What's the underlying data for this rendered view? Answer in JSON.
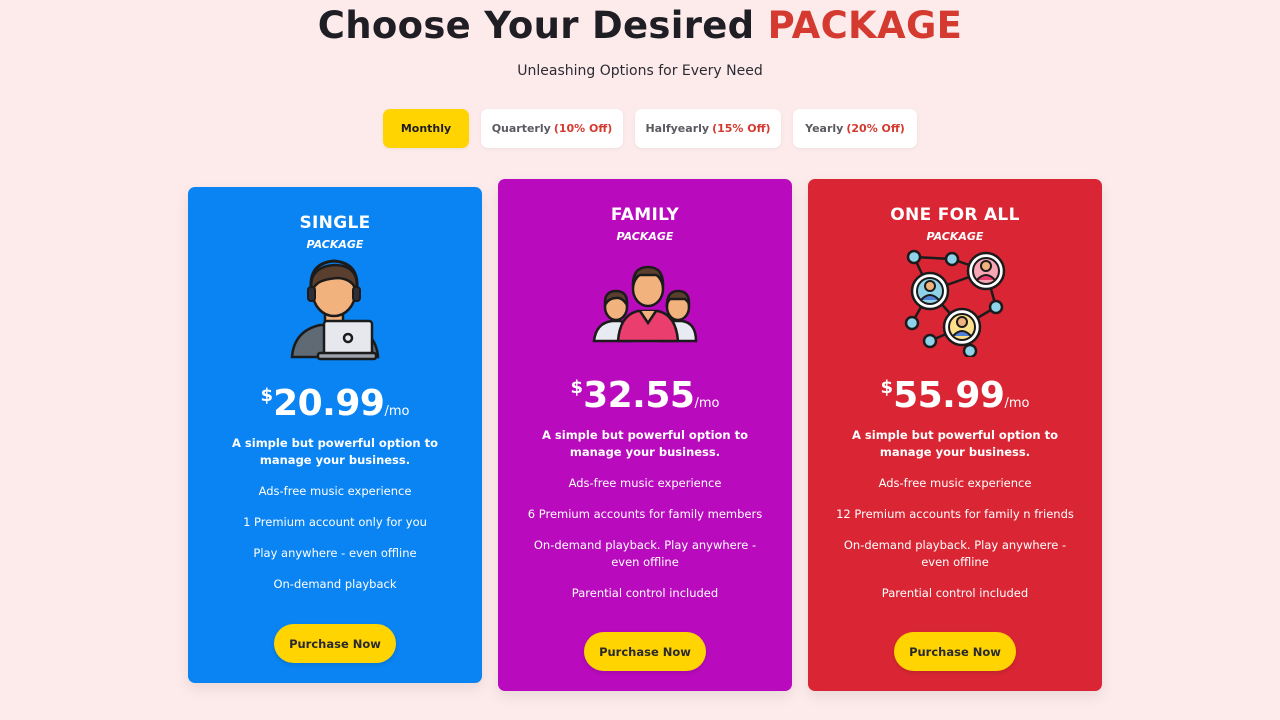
{
  "header": {
    "title_main": "Choose Your Desired",
    "title_accent": "PACKAGE",
    "subtitle": "Unleashing Options for Every Need"
  },
  "tabs": [
    {
      "label": "Monthly",
      "discount": "",
      "active": true
    },
    {
      "label": "Quarterly",
      "discount": "(10% Off)",
      "active": false
    },
    {
      "label": "Halfyearly",
      "discount": "(15% Off)",
      "active": false
    },
    {
      "label": "Yearly",
      "discount": "(20% Off)",
      "active": false
    }
  ],
  "plans": [
    {
      "name": "SINGLE",
      "tag": "PACKAGE",
      "icon": "person-laptop-icon",
      "currency": "$",
      "price": "20.99",
      "period": "/mo",
      "description": "A simple but powerful option to manage your business.",
      "features": [
        "Ads-free music experience",
        "1 Premium account only for you",
        "Play anywhere - even offline",
        "On-demand playback"
      ],
      "button": "Purchase Now",
      "color": "#0a84f2"
    },
    {
      "name": "FAMILY",
      "tag": "PACKAGE",
      "icon": "family-icon",
      "currency": "$",
      "price": "32.55",
      "period": "/mo",
      "description": "A simple but powerful option to manage your business.",
      "features": [
        "Ads-free music experience",
        "6 Premium accounts for family members",
        "On-demand playback. Play anywhere - even offline",
        "Parential control included"
      ],
      "button": "Purchase Now",
      "color": "#b90bbd"
    },
    {
      "name": "ONE FOR ALL",
      "tag": "PACKAGE",
      "icon": "network-users-icon",
      "currency": "$",
      "price": "55.99",
      "period": "/mo",
      "description": "A simple but powerful option to manage your business.",
      "features": [
        "Ads-free music experience",
        "12 Premium accounts for family n friends",
        "On-demand playback. Play anywhere - even offline",
        "Parential control included"
      ],
      "button": "Purchase Now",
      "color": "#da2634"
    }
  ]
}
